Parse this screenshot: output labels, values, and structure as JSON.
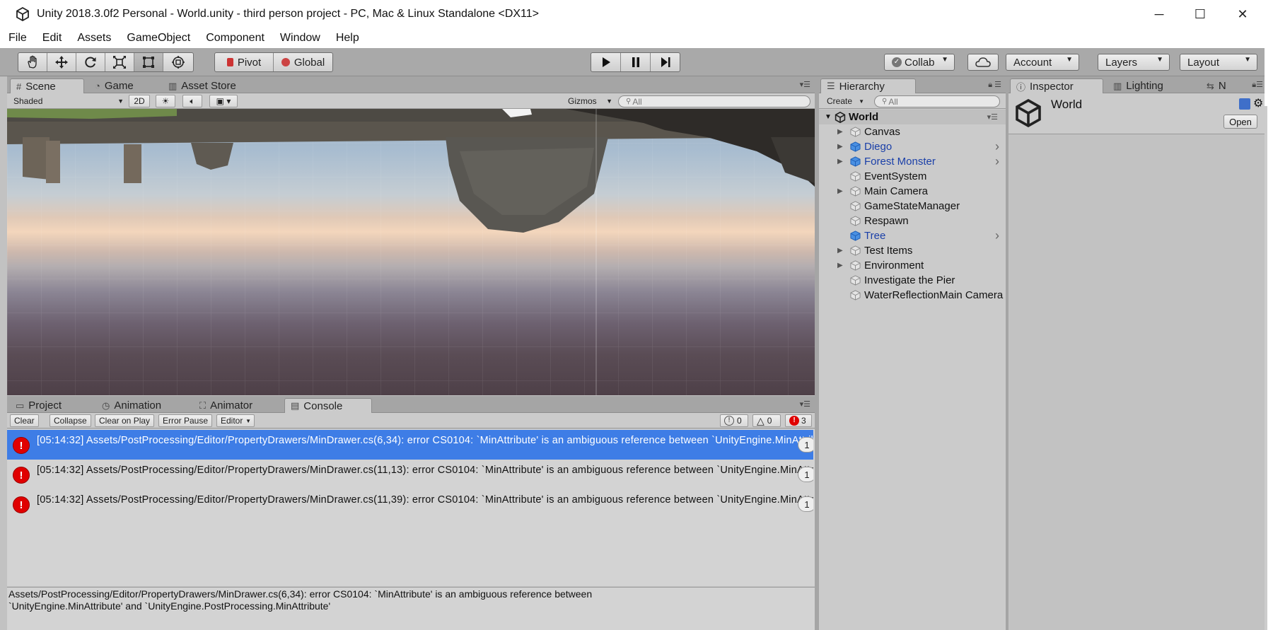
{
  "window": {
    "title": "Unity 2018.3.0f2 Personal - World.unity - third person project - PC, Mac & Linux Standalone <DX11>",
    "min_glyph": "─",
    "max_glyph": "☐",
    "close_glyph": "✕"
  },
  "menu": [
    "File",
    "Edit",
    "Assets",
    "GameObject",
    "Component",
    "Window",
    "Help"
  ],
  "toolbar": {
    "tools": [
      "hand-tool",
      "move-tool",
      "rotate-tool",
      "scale-tool",
      "rect-tool",
      "transform-tool"
    ],
    "pivot_label": "Pivot",
    "global_label": "Global",
    "collab_label": "Collab",
    "account_label": "Account",
    "layers_label": "Layers",
    "layout_label": "Layout"
  },
  "scene_panel": {
    "tabs": [
      "Scene",
      "Game",
      "Asset Store"
    ],
    "shading_mode": "Shaded",
    "mode_2d": "2D",
    "gizmos_label": "Gizmos",
    "search_placeholder": "All"
  },
  "hierarchy": {
    "tab": "Hierarchy",
    "create_label": "Create",
    "search_placeholder": "All",
    "root": "World",
    "items": [
      {
        "name": "Canvas",
        "expandable": true,
        "prefab": false,
        "more": false
      },
      {
        "name": "Diego",
        "expandable": true,
        "prefab": true,
        "more": true
      },
      {
        "name": "Forest Monster",
        "expandable": true,
        "prefab": true,
        "more": true
      },
      {
        "name": "EventSystem",
        "expandable": false,
        "prefab": false,
        "more": false
      },
      {
        "name": "Main Camera",
        "expandable": true,
        "prefab": false,
        "more": false
      },
      {
        "name": "GameStateManager",
        "expandable": false,
        "prefab": false,
        "more": false
      },
      {
        "name": "Respawn",
        "expandable": false,
        "prefab": false,
        "more": false
      },
      {
        "name": "Tree",
        "expandable": false,
        "prefab": true,
        "more": true
      },
      {
        "name": "Test Items",
        "expandable": true,
        "prefab": false,
        "more": false
      },
      {
        "name": "Environment",
        "expandable": true,
        "prefab": false,
        "more": false
      },
      {
        "name": "Investigate the Pier",
        "expandable": false,
        "prefab": false,
        "more": false
      },
      {
        "name": "WaterReflectionMain Camera",
        "expandable": false,
        "prefab": false,
        "more": false
      }
    ]
  },
  "inspector": {
    "tabs": [
      "Inspector",
      "Lighting",
      "N"
    ],
    "object_name": "World",
    "open_label": "Open"
  },
  "bottom_panel": {
    "tabs": [
      "Project",
      "Animation",
      "Animator",
      "Console"
    ],
    "buttons": [
      "Clear",
      "Collapse",
      "Clear on Play",
      "Error Pause",
      "Editor"
    ],
    "info_count": "0",
    "warning_count": "0",
    "error_count": "3"
  },
  "console": {
    "entries": [
      {
        "text": "[05:14:32] Assets/PostProcessing/Editor/PropertyDrawers/MinDrawer.cs(6,34): error CS0104: `MinAttribute' is an ambiguous reference between `UnityEngine.MinAttribute'",
        "count": "1",
        "selected": true
      },
      {
        "text": "[05:14:32] Assets/PostProcessing/Editor/PropertyDrawers/MinDrawer.cs(11,13): error CS0104: `MinAttribute' is an ambiguous reference between `UnityEngine.MinAttribute'",
        "count": "1",
        "selected": false
      },
      {
        "text": "[05:14:32] Assets/PostProcessing/Editor/PropertyDrawers/MinDrawer.cs(11,39): error CS0104: `MinAttribute' is an ambiguous reference between `UnityEngine.MinAttribute'",
        "count": "1",
        "selected": false
      }
    ],
    "detail_line1": "Assets/PostProcessing/Editor/PropertyDrawers/MinDrawer.cs(6,34): error CS0104: `MinAttribute' is an ambiguous reference between",
    "detail_line2": "`UnityEngine.MinAttribute' and `UnityEngine.PostProcessing.MinAttribute'"
  },
  "colors": {
    "selection": "#3e7de6",
    "error_red": "#e00000",
    "prefab_blue": "#1a3fa8",
    "panel_gray": "#c2c2c2"
  }
}
